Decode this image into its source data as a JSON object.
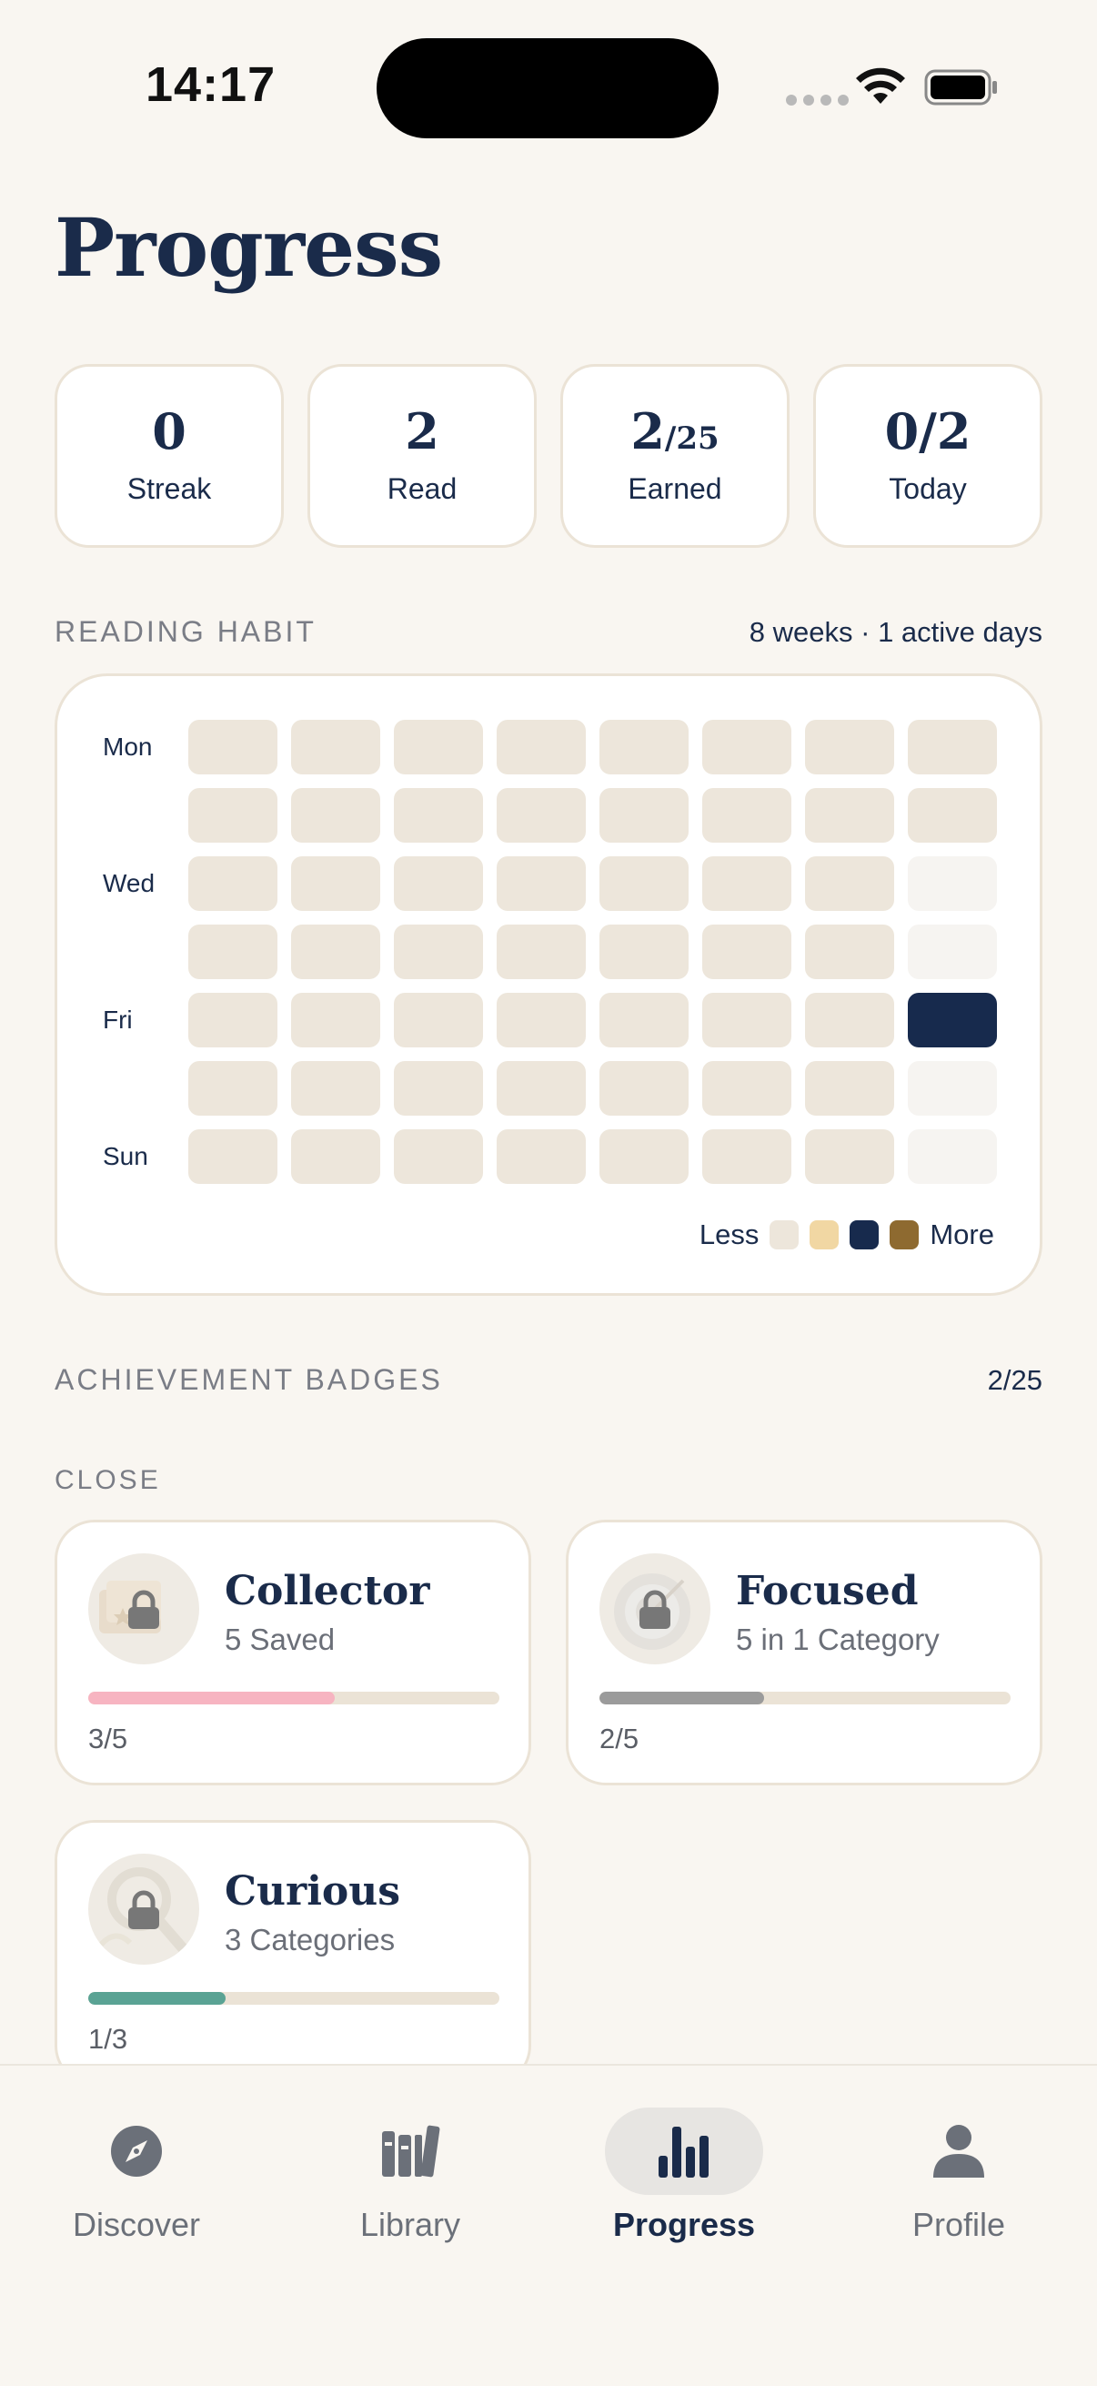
{
  "status_bar": {
    "time": "14:17"
  },
  "title": "Progress",
  "stats": [
    {
      "value": "0",
      "label": "Streak"
    },
    {
      "value": "2",
      "label": "Read"
    },
    {
      "value": "2",
      "value_small": "/25",
      "label": "Earned"
    },
    {
      "value": "0/2",
      "label": "Today"
    }
  ],
  "reading_habit": {
    "title": "READING HABIT",
    "meta": "8 weeks · 1 active days",
    "day_labels": [
      "Mon",
      "Wed",
      "Fri",
      "Sun"
    ],
    "weeks": 8,
    "active": [
      {
        "week": 7,
        "day": "Fri"
      }
    ],
    "legend": {
      "less": "Less",
      "more": "More",
      "colors": [
        "#ede6db",
        "#f1d7a3",
        "#172a4d",
        "#8e6a30"
      ]
    }
  },
  "achievements": {
    "title": "ACHIEVEMENT BADGES",
    "count": "2/25",
    "group_label": "CLOSE",
    "badges": [
      {
        "name": "Collector",
        "desc": "5 Saved",
        "progress": "3/5",
        "fraction": 0.6,
        "color": "#f7b4c1",
        "icon": "collector-badge-icon"
      },
      {
        "name": "Focused",
        "desc": "5 in 1 Category",
        "progress": "2/5",
        "fraction": 0.4,
        "color": "#9b9b9b",
        "icon": "target-badge-icon"
      },
      {
        "name": "Curious",
        "desc": "3 Categories",
        "progress": "1/3",
        "fraction": 0.3333,
        "color": "#5aa394",
        "icon": "magnifier-badge-icon"
      }
    ]
  },
  "tabs": [
    {
      "label": "Discover",
      "icon": "compass-icon"
    },
    {
      "label": "Library",
      "icon": "books-icon"
    },
    {
      "label": "Progress",
      "icon": "bar-chart-icon",
      "active": true
    },
    {
      "label": "Profile",
      "icon": "person-icon"
    }
  ]
}
